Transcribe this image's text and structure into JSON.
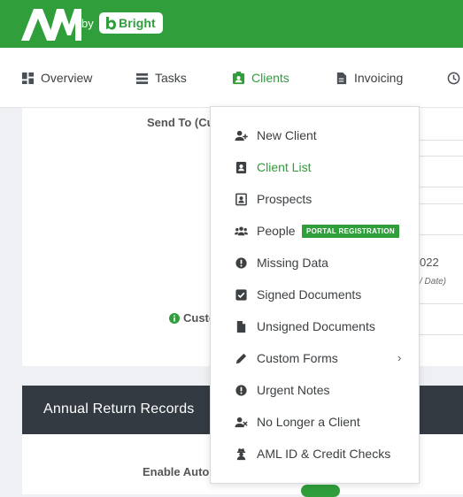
{
  "brand": {
    "by_text": "by",
    "name": "Bright",
    "logo_text": "AM"
  },
  "nav": {
    "items": [
      {
        "label": "Overview",
        "icon": "grid-icon"
      },
      {
        "label": "Tasks",
        "icon": "list-icon"
      },
      {
        "label": "Clients",
        "icon": "contact-card-icon",
        "active": true
      },
      {
        "label": "Invoicing",
        "icon": "document-icon"
      }
    ]
  },
  "background": {
    "send_to_label": "Send To (Cu",
    "custom_label": "Custo",
    "year_fragment": "022",
    "date_hint": "/ Date)",
    "annual_title": "Annual Return Records",
    "enable_label": "Enable Auto"
  },
  "menu": {
    "items": [
      {
        "label": "New Client",
        "icon": "user-plus-icon"
      },
      {
        "label": "Client List",
        "icon": "contact-book-icon",
        "active": true
      },
      {
        "label": "Prospects",
        "icon": "portrait-icon"
      },
      {
        "label": "People",
        "icon": "users-icon",
        "badge": "PORTAL REGISTRATION"
      },
      {
        "label": "Missing Data",
        "icon": "exclamation-circle-icon"
      },
      {
        "label": "Signed Documents",
        "icon": "check-square-icon"
      },
      {
        "label": "Unsigned Documents",
        "icon": "file-icon"
      },
      {
        "label": "Custom Forms",
        "icon": "pencil-icon",
        "submenu_indicator": "›"
      },
      {
        "label": "Urgent Notes",
        "icon": "exclamation-circle-icon"
      },
      {
        "label": "No Longer a Client",
        "icon": "user-x-icon"
      },
      {
        "label": "AML ID & Credit Checks",
        "icon": "user-secret-icon"
      }
    ]
  },
  "colors": {
    "brand_green": "#2f9e3b",
    "dark_header": "#333a42"
  }
}
